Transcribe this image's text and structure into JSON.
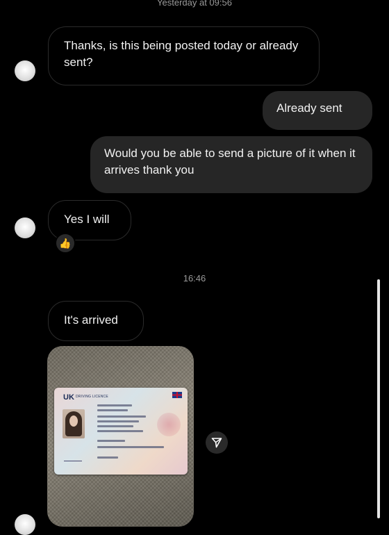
{
  "thread": {
    "timestamp_top": "Yesterday at 09:56",
    "timestamp_mid": "16:46",
    "messages": [
      {
        "side": "incoming",
        "text": "Thanks, is this being posted today or already sent?"
      },
      {
        "side": "outgoing",
        "text": "Already sent"
      },
      {
        "side": "outgoing",
        "text": "Would you be able to send a picture of it when it arrives thank you"
      },
      {
        "side": "incoming",
        "text": "Yes I will"
      },
      {
        "side": "incoming",
        "text": "It's arrived"
      }
    ],
    "reaction": "👍",
    "photo": {
      "card_country": "UK",
      "card_title": "DRIVING LICENCE"
    },
    "icons": {
      "send": "send-icon",
      "reaction": "thumbs-up-icon",
      "avatar": "avatar"
    }
  }
}
